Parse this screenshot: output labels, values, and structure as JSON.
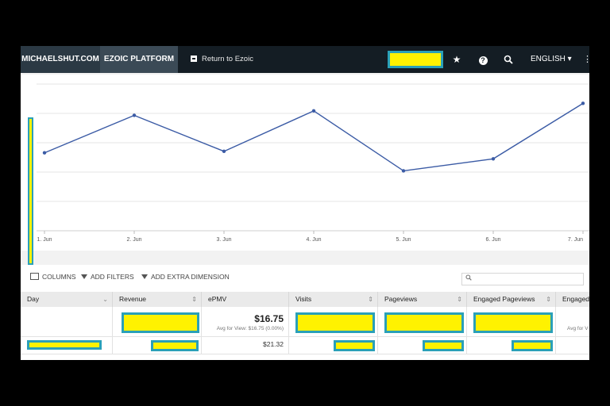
{
  "topbar": {
    "site_tab": "MICHAELSHUT.COM",
    "platform_tab": "EZOIC PLATFORM",
    "return_link": "Return to Ezoic",
    "star_icon": "★",
    "help_icon": "?",
    "search_icon": "⚲",
    "language": "ENGLISH ▾",
    "menu_icon": "⋮"
  },
  "chart_data": {
    "type": "line",
    "x": [
      "1. Jun",
      "2. Jun",
      "3. Jun",
      "4. Jun",
      "5. Jun",
      "6. Jun",
      "7. Jun"
    ],
    "series": [
      {
        "values": [
          52,
          77,
          53,
          80,
          40,
          48,
          85
        ]
      }
    ],
    "ylim": [
      0,
      100
    ],
    "grid": true,
    "color": "#3b5ba5",
    "ylabel": "",
    "xlabel": ""
  },
  "toolbar": {
    "columns": "COLUMNS",
    "filters": "ADD FILTERS",
    "extra": "ADD EXTRA DIMENSION",
    "search_placeholder": ""
  },
  "table": {
    "headers": [
      "Day",
      "Revenue",
      "ePMV",
      "Visits",
      "Pageviews",
      "Engaged Pageviews",
      "Engaged P"
    ],
    "summary": {
      "epmv": "$16.75",
      "epmv_avg": "Avg for View: $16.75 (0.00%)",
      "engaged_avg": "Avg for V"
    },
    "rows": [
      {
        "epmv": "$21.32"
      }
    ]
  }
}
